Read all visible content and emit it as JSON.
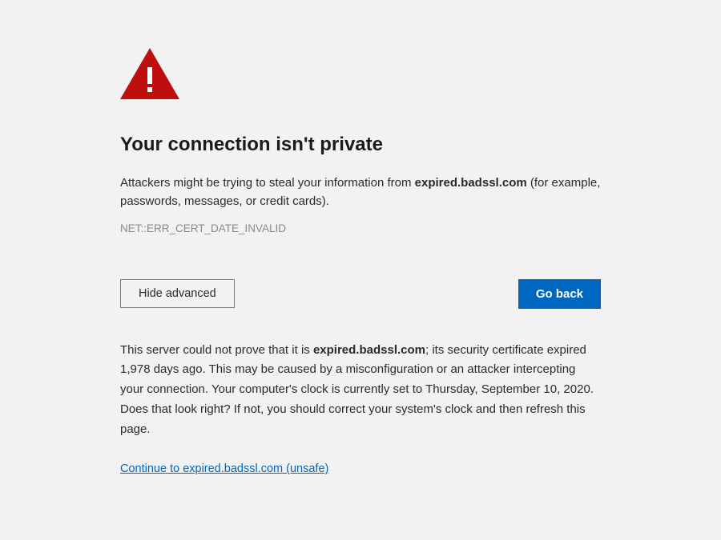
{
  "colors": {
    "warning": "#c00d0d",
    "primary": "#0067c0"
  },
  "title": "Your connection isn't private",
  "description": {
    "pre": "Attackers might be trying to steal your information from ",
    "host": "expired.badssl.com",
    "post": " (for example, passwords, messages, or credit cards)."
  },
  "error_code": "NET::ERR_CERT_DATE_INVALID",
  "buttons": {
    "advanced": "Hide advanced",
    "go_back": "Go back"
  },
  "details": {
    "pre": "This server could not prove that it is ",
    "host": "expired.badssl.com",
    "post": "; its security certificate expired 1,978 days ago. This may be caused by a misconfiguration or an attacker intercepting your connection. Your computer's clock is currently set to Thursday, September 10, 2020. Does that look right? If not, you should correct your system's clock and then refresh this page."
  },
  "unsafe_link": "Continue to expired.badssl.com (unsafe)"
}
